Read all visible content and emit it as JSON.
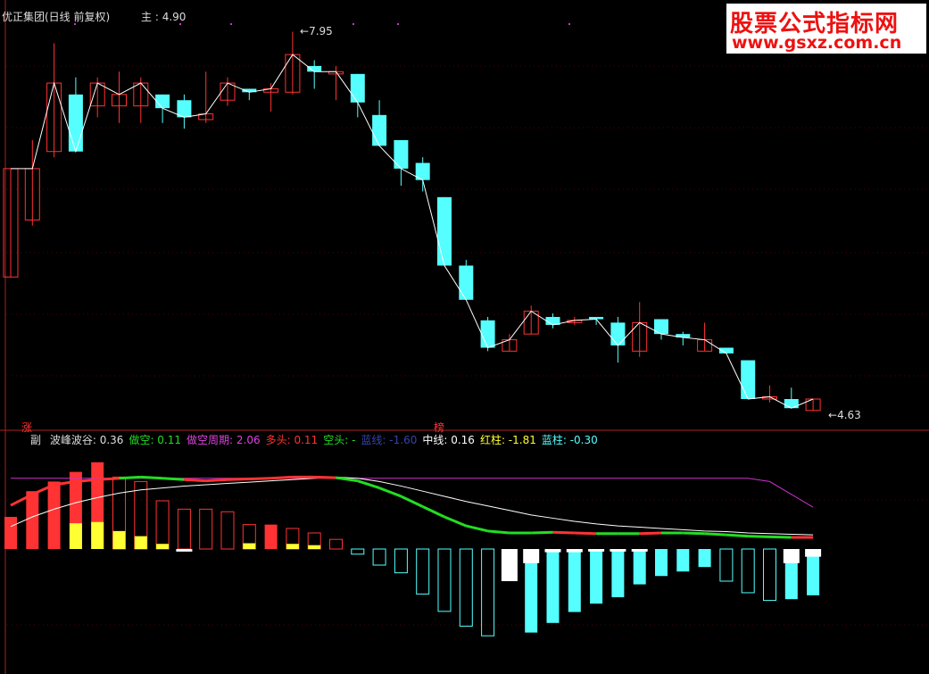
{
  "main_header": {
    "title": "优正集团(日线 前复权)",
    "indicator_label": "主",
    "price": "4.90"
  },
  "price_labels": {
    "high": "7.95",
    "low": "4.63"
  },
  "watermark": {
    "line1": "股票公式指标网",
    "line2": "www.gsxz.com.cn"
  },
  "sub_header": {
    "prefix": "副",
    "items": [
      {
        "label": "波峰波谷:",
        "value": "0.36",
        "color": "#ffffff"
      },
      {
        "label": "做空:",
        "value": "0.11",
        "color": "#22dd22"
      },
      {
        "label": "做空周期:",
        "value": "2.06",
        "color": "#dd44dd"
      },
      {
        "label": "多头:",
        "value": "0.11",
        "color": "#ff3333"
      },
      {
        "label": "空头:",
        "value": "-",
        "color": "#22dd22"
      },
      {
        "label": "蓝线:",
        "value": "-1.60",
        "color": "#3344aa"
      },
      {
        "label": "中线:",
        "value": "0.16",
        "color": "#ffffff"
      },
      {
        "label": "红柱:",
        "value": "-1.81",
        "color": "#ffff33"
      },
      {
        "label": "蓝柱:",
        "value": "-0.30",
        "color": "#55ffff"
      }
    ]
  },
  "markers": {
    "zhang": "涨",
    "bang": "榜"
  },
  "colors": {
    "up": "#ff3333",
    "down": "#55ffff",
    "axis": "#aa2222",
    "grid": "#550000",
    "yellow": "#ffff33",
    "white": "#ffffff",
    "green": "#22dd22",
    "magenta": "#cc33cc"
  },
  "chart_data": {
    "type": "candlestick",
    "candles": [
      {
        "o": 5.8,
        "c": 6.75,
        "h": 6.75,
        "l": 5.8
      },
      {
        "o": 6.3,
        "c": 6.75,
        "h": 7.0,
        "l": 6.25
      },
      {
        "o": 6.9,
        "c": 7.5,
        "h": 7.85,
        "l": 6.85
      },
      {
        "o": 7.4,
        "c": 6.9,
        "h": 7.55,
        "l": 6.9
      },
      {
        "o": 7.3,
        "c": 7.5,
        "h": 7.55,
        "l": 7.2
      },
      {
        "o": 7.3,
        "c": 7.4,
        "h": 7.6,
        "l": 7.15
      },
      {
        "o": 7.3,
        "c": 7.5,
        "h": 7.55,
        "l": 7.15
      },
      {
        "o": 7.4,
        "c": 7.28,
        "h": 7.4,
        "l": 7.15
      },
      {
        "o": 7.35,
        "c": 7.2,
        "h": 7.4,
        "l": 7.1
      },
      {
        "o": 7.18,
        "c": 7.23,
        "h": 7.6,
        "l": 7.15
      },
      {
        "o": 7.35,
        "c": 7.5,
        "h": 7.55,
        "l": 7.3
      },
      {
        "o": 7.45,
        "c": 7.42,
        "h": 7.45,
        "l": 7.35
      },
      {
        "o": 7.42,
        "c": 7.45,
        "h": 7.5,
        "l": 7.25
      },
      {
        "o": 7.42,
        "c": 7.75,
        "h": 7.95,
        "l": 7.4
      },
      {
        "o": 7.65,
        "c": 7.6,
        "h": 7.7,
        "l": 7.45
      },
      {
        "o": 7.58,
        "c": 7.6,
        "h": 7.65,
        "l": 7.35
      },
      {
        "o": 7.58,
        "c": 7.33,
        "h": 7.58,
        "l": 7.2
      },
      {
        "o": 7.22,
        "c": 6.95,
        "h": 7.35,
        "l": 6.95
      },
      {
        "o": 7.0,
        "c": 6.75,
        "h": 7.0,
        "l": 6.6
      },
      {
        "o": 6.8,
        "c": 6.65,
        "h": 6.85,
        "l": 6.55
      },
      {
        "o": 6.5,
        "c": 5.9,
        "h": 6.5,
        "l": 5.9
      },
      {
        "o": 5.9,
        "c": 5.6,
        "h": 5.95,
        "l": 5.6
      },
      {
        "o": 5.42,
        "c": 5.18,
        "h": 5.45,
        "l": 5.15
      },
      {
        "o": 5.15,
        "c": 5.25,
        "h": 5.3,
        "l": 5.15
      },
      {
        "o": 5.3,
        "c": 5.5,
        "h": 5.55,
        "l": 5.3
      },
      {
        "o": 5.45,
        "c": 5.38,
        "h": 5.48,
        "l": 5.35
      },
      {
        "o": 5.4,
        "c": 5.42,
        "h": 5.45,
        "l": 5.38
      },
      {
        "o": 5.45,
        "c": 5.43,
        "h": 5.45,
        "l": 5.38
      },
      {
        "o": 5.4,
        "c": 5.2,
        "h": 5.45,
        "l": 5.05
      },
      {
        "o": 5.15,
        "c": 5.4,
        "h": 5.58,
        "l": 5.1
      },
      {
        "o": 5.43,
        "c": 5.3,
        "h": 5.43,
        "l": 5.25
      },
      {
        "o": 5.3,
        "c": 5.27,
        "h": 5.32,
        "l": 5.2
      },
      {
        "o": 5.15,
        "c": 5.25,
        "h": 5.4,
        "l": 5.15
      },
      {
        "o": 5.18,
        "c": 5.13,
        "h": 5.18,
        "l": 5.13
      },
      {
        "o": 5.07,
        "c": 4.73,
        "h": 5.07,
        "l": 4.73
      },
      {
        "o": 4.73,
        "c": 4.75,
        "h": 4.85,
        "l": 4.7
      },
      {
        "o": 4.73,
        "c": 4.65,
        "h": 4.83,
        "l": 4.65
      },
      {
        "o": 4.63,
        "c": 4.73,
        "h": 4.73,
        "l": 4.63
      }
    ],
    "sub_bars": [
      {
        "v": 0.5,
        "kind": "red_filled"
      },
      {
        "v": 0.9,
        "kind": "red_filled"
      },
      {
        "v": 1.05,
        "kind": "red_filled"
      },
      {
        "v": 1.2,
        "kind": "red_filled",
        "yellow": 0.4
      },
      {
        "v": 1.35,
        "kind": "red_filled",
        "yellow": 0.42
      },
      {
        "v": 1.12,
        "kind": "red_hollow",
        "yellow": 0.28
      },
      {
        "v": 1.05,
        "kind": "red_hollow",
        "yellow": 0.2
      },
      {
        "v": 0.75,
        "kind": "red_hollow",
        "yellow": 0.08
      },
      {
        "v": 0.62,
        "kind": "red_hollow",
        "white": 0.04
      },
      {
        "v": 0.62,
        "kind": "red_hollow"
      },
      {
        "v": 0.58,
        "kind": "red_hollow"
      },
      {
        "v": 0.38,
        "kind": "red_hollow",
        "yellow": 0.09
      },
      {
        "v": 0.38,
        "kind": "red_filled"
      },
      {
        "v": 0.32,
        "kind": "red_hollow",
        "yellow": 0.08
      },
      {
        "v": 0.25,
        "kind": "red_hollow",
        "yellow": 0.06
      },
      {
        "v": 0.15,
        "kind": "red_hollow"
      },
      {
        "v": -0.08,
        "kind": "cyan_hollow"
      },
      {
        "v": -0.25,
        "kind": "cyan_hollow"
      },
      {
        "v": -0.37,
        "kind": "cyan_hollow"
      },
      {
        "v": -0.7,
        "kind": "cyan_hollow"
      },
      {
        "v": -0.97,
        "kind": "cyan_hollow"
      },
      {
        "v": -1.2,
        "kind": "cyan_hollow"
      },
      {
        "v": -1.35,
        "kind": "cyan_hollow"
      },
      {
        "v": -0.5,
        "kind": "cyan_filled",
        "white": 0.5
      },
      {
        "v": -1.3,
        "kind": "cyan_filled",
        "white": 0.22
      },
      {
        "v": -1.15,
        "kind": "cyan_filled",
        "white": 0.05
      },
      {
        "v": -0.98,
        "kind": "cyan_filled",
        "white": 0.05
      },
      {
        "v": -0.85,
        "kind": "cyan_filled",
        "white": 0.04
      },
      {
        "v": -0.75,
        "kind": "cyan_filled",
        "white": 0.04
      },
      {
        "v": -0.55,
        "kind": "cyan_filled",
        "white": 0.04
      },
      {
        "v": -0.42,
        "kind": "cyan_filled"
      },
      {
        "v": -0.35,
        "kind": "cyan_filled"
      },
      {
        "v": -0.28,
        "kind": "cyan_filled"
      },
      {
        "v": -0.5,
        "kind": "cyan_hollow"
      },
      {
        "v": -0.68,
        "kind": "cyan_hollow"
      },
      {
        "v": -0.8,
        "kind": "cyan_hollow"
      },
      {
        "v": -0.78,
        "kind": "cyan_filled",
        "white": 0.22
      },
      {
        "v": -0.72,
        "kind": "cyan_filled",
        "white": 0.12
      }
    ],
    "upper_line": [
      0.68,
      0.85,
      1.0,
      1.05,
      1.08,
      1.1,
      1.12,
      1.1,
      1.08,
      1.06,
      1.08,
      1.09,
      1.1,
      1.12,
      1.12,
      1.11,
      1.06,
      0.95,
      0.82,
      0.66,
      0.5,
      0.36,
      0.28,
      0.25,
      0.25,
      0.26,
      0.25,
      0.24,
      0.24,
      0.24,
      0.25,
      0.25,
      0.24,
      0.22,
      0.2,
      0.19,
      0.18,
      0.18
    ],
    "upper_line_colors": [
      "red",
      "red",
      "red",
      "red",
      "red",
      "red",
      "green",
      "green",
      "green",
      "red",
      "red",
      "red",
      "red",
      "red",
      "red",
      "red",
      "green",
      "green",
      "green",
      "green",
      "green",
      "green",
      "green",
      "green",
      "green",
      "green",
      "red",
      "red",
      "green",
      "green",
      "red",
      "green",
      "green",
      "green",
      "green",
      "green",
      "green",
      "red"
    ],
    "white_line": [
      0.35,
      0.5,
      0.62,
      0.72,
      0.8,
      0.87,
      0.92,
      0.95,
      0.98,
      1.0,
      1.02,
      1.04,
      1.06,
      1.08,
      1.1,
      1.12,
      1.1,
      1.05,
      0.98,
      0.9,
      0.82,
      0.74,
      0.67,
      0.6,
      0.53,
      0.48,
      0.43,
      0.39,
      0.36,
      0.34,
      0.32,
      0.3,
      0.28,
      0.27,
      0.25,
      0.24,
      0.23,
      0.22
    ],
    "magenta_line": [
      1.1,
      1.1,
      1.1,
      1.1,
      1.1,
      1.1,
      1.1,
      1.1,
      1.1,
      1.1,
      1.1,
      1.1,
      1.1,
      1.1,
      1.1,
      1.1,
      1.1,
      1.1,
      1.1,
      1.1,
      1.1,
      1.1,
      1.1,
      1.1,
      1.1,
      1.1,
      1.1,
      1.1,
      1.1,
      1.1,
      1.1,
      1.1,
      1.1,
      1.1,
      1.1,
      1.05,
      0.85,
      0.65
    ]
  }
}
